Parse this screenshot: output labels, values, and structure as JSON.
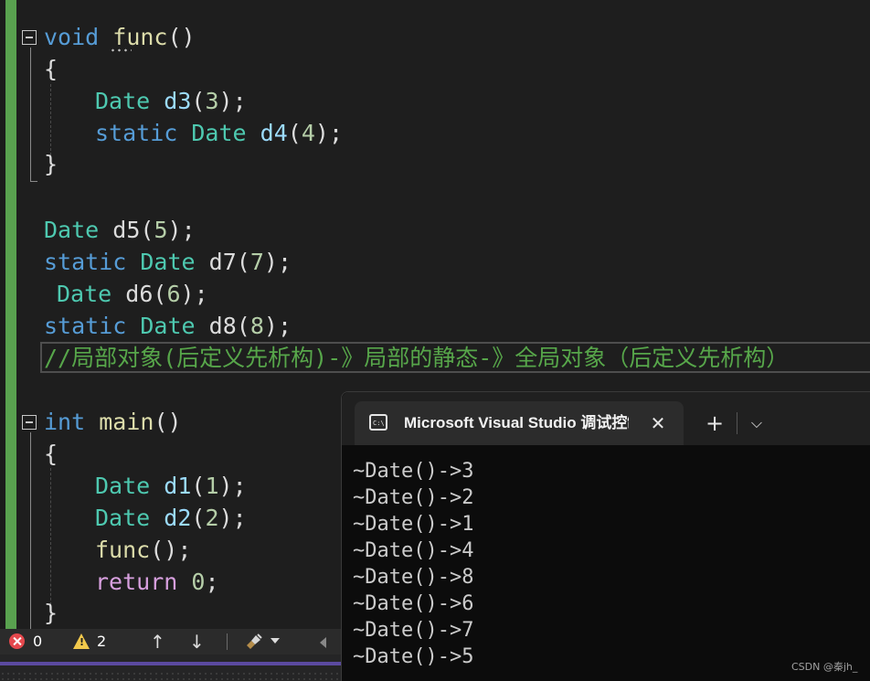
{
  "editor": {
    "lines": {
      "l1": {
        "kw": "void",
        "fn": "func",
        "p": "()"
      },
      "l2": {
        "text": "{"
      },
      "l3": {
        "ty": "Date",
        "var": "d3",
        "open": "(",
        "num": "3",
        "close": ");"
      },
      "l4": {
        "kw": "static",
        "ty": "Date",
        "var": "d4",
        "open": "(",
        "num": "4",
        "close": ");"
      },
      "l5": {
        "text": "}"
      },
      "l6": {
        "ty": "Date",
        "name": "d5",
        "open": "(",
        "num": "5",
        "close": ");"
      },
      "l7": {
        "kw": "static",
        "ty": "Date",
        "name": "d7",
        "open": "(",
        "num": "7",
        "close": ");"
      },
      "l8": {
        "ty": "Date",
        "name": "d6",
        "open": "(",
        "num": "6",
        "close": ");"
      },
      "l9": {
        "kw": "static",
        "ty": "Date",
        "name": "d8",
        "open": "(",
        "num": "8",
        "close": ");"
      },
      "l10": {
        "comment": "//局部对象(后定义先析构)-》局部的静态-》全局对象（后定义先析构）"
      },
      "l11": {
        "kw": "int",
        "fn": "main",
        "p": "()"
      },
      "l12": {
        "text": "{"
      },
      "l13": {
        "ty": "Date",
        "var": "d1",
        "open": "(",
        "num": "1",
        "close": ");"
      },
      "l14": {
        "ty": "Date",
        "var": "d2",
        "open": "(",
        "num": "2",
        "close": ");"
      },
      "l15": {
        "fn": "func",
        "rest": "();"
      },
      "l16": {
        "kw": "return",
        "num": "0",
        "rest": ";"
      },
      "l17": {
        "text": "}"
      }
    }
  },
  "statusbar": {
    "errors": "0",
    "warnings": "2",
    "up_arrow": "↑",
    "down_arrow": "↓"
  },
  "terminal": {
    "tab_title": "Microsoft Visual Studio 调试控制台",
    "close": "✕",
    "new_tab": "+",
    "dropdown": "⌵",
    "icon_text": "C:\\",
    "output": [
      "~Date()->3",
      "~Date()->2",
      "~Date()->1",
      "~Date()->4",
      "~Date()->8",
      "~Date()->6",
      "~Date()->7",
      "~Date()->5"
    ]
  },
  "watermark": "CSDN @秦jh_",
  "colors": {
    "keyword": "#569cd6",
    "type": "#4ec9b0",
    "function": "#dcdcaa",
    "variable": "#9cdcfe",
    "number": "#b5cea8",
    "comment": "#57a64a",
    "control_keyword": "#d8a0df",
    "change_bar": "#59a14f"
  }
}
